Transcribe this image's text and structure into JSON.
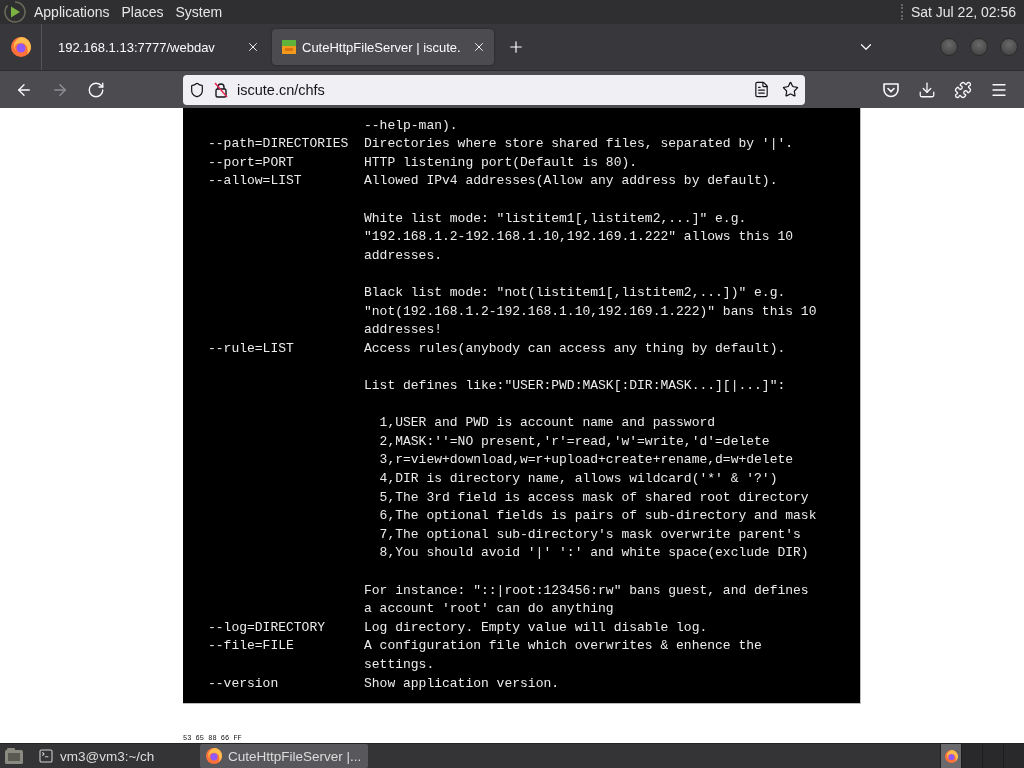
{
  "top_panel": {
    "menus": [
      "Applications",
      "Places",
      "System"
    ],
    "clock": "Sat Jul 22, 02:56"
  },
  "browser": {
    "tabs": [
      {
        "title": "192.168.1.13:7777/webdav",
        "favicon": false,
        "selected": false
      },
      {
        "title": "CuteHttpFileServer | iscute.",
        "favicon": true,
        "selected": true
      }
    ],
    "nav_buttons": [
      {
        "kind": "back",
        "disabled": false
      },
      {
        "kind": "forward",
        "disabled": true
      },
      {
        "kind": "reload",
        "disabled": false
      }
    ],
    "address_bar": {
      "url": "iscute.cn/chfs"
    }
  },
  "help_text": {
    "options": [
      {
        "paragraphs": [
          {
            "kind": "text",
            "lines": [
              "--help-man)."
            ]
          }
        ]
      },
      {
        "flag": "--path=DIRECTORIES",
        "paragraphs": [
          {
            "kind": "text",
            "lines": [
              "Directories where store shared files, separated by '|'."
            ]
          }
        ]
      },
      {
        "flag": "--port=PORT",
        "paragraphs": [
          {
            "kind": "text",
            "lines": [
              "HTTP listening port(Default is 80)."
            ]
          }
        ]
      },
      {
        "flag": "--allow=LIST",
        "paragraphs": [
          {
            "kind": "text",
            "lines": [
              "Allowed IPv4 addresses(Allow any address by default)."
            ]
          },
          {
            "kind": "text",
            "lines": [
              "White list mode: \"listitem1[,listitem2,...]\" e.g.",
              "\"192.168.1.2-192.168.1.10,192.169.1.222\" allows this 10",
              "addresses."
            ]
          },
          {
            "kind": "text",
            "lines": [
              "Black list mode: \"not(listitem1[,listitem2,...])\" e.g.",
              "\"not(192.168.1.2-192.168.1.10,192.169.1.222)\" bans this 10",
              "addresses!"
            ]
          }
        ]
      },
      {
        "flag": "--rule=LIST",
        "paragraphs": [
          {
            "kind": "text",
            "lines": [
              "Access rules(anybody can access any thing by default)."
            ]
          },
          {
            "kind": "text",
            "lines": [
              "List defines like:\"USER:PWD:MASK[:DIR:MASK...][|...]\":"
            ]
          },
          {
            "kind": "list",
            "lines": [
              "1,USER and PWD is account name and password",
              "2,MASK:''=NO present,'r'=read,'w'=write,'d'=delete",
              "3,r=view+download,w=r+upload+create+rename,d=w+delete",
              "4,DIR is directory name, allows wildcard('*' & '?')",
              "5,The 3rd field is access mask of shared root directory",
              "6,The optional fields is pairs of sub-directory and mask",
              "7,The optional sub-directory's mask overwrite parent's",
              "8,You should avoid '|' ':' and white space(exclude DIR)"
            ]
          },
          {
            "kind": "text",
            "lines": [
              "For instance: \"::|root:123456:rw\" bans guest, and defines",
              "a account 'root' can do anything"
            ]
          }
        ]
      },
      {
        "flag": "--log=DIRECTORY",
        "paragraphs": [
          {
            "kind": "text",
            "lines": [
              "Log directory. Empty value will disable log."
            ]
          }
        ]
      },
      {
        "flag": "--file=FILE",
        "paragraphs": [
          {
            "kind": "text",
            "lines": [
              "A configuration file which overwrites & enhence the",
              "settings."
            ]
          }
        ]
      },
      {
        "flag": "--version",
        "paragraphs": [
          {
            "kind": "text",
            "lines": [
              "Show application version."
            ]
          }
        ]
      }
    ]
  },
  "pixel_readout": "53 65 88 66 FF",
  "taskbar": {
    "tasks": [
      {
        "kind": "terminal",
        "title": "vm3@vm3:~/ch",
        "selected": false
      },
      {
        "kind": "browser",
        "title": "CuteHttpFileServer |...",
        "selected": true
      }
    ],
    "workspaces": [
      {
        "selected": true
      },
      {
        "selected": false
      },
      {
        "selected": false
      },
      {
        "selected": false
      }
    ]
  }
}
